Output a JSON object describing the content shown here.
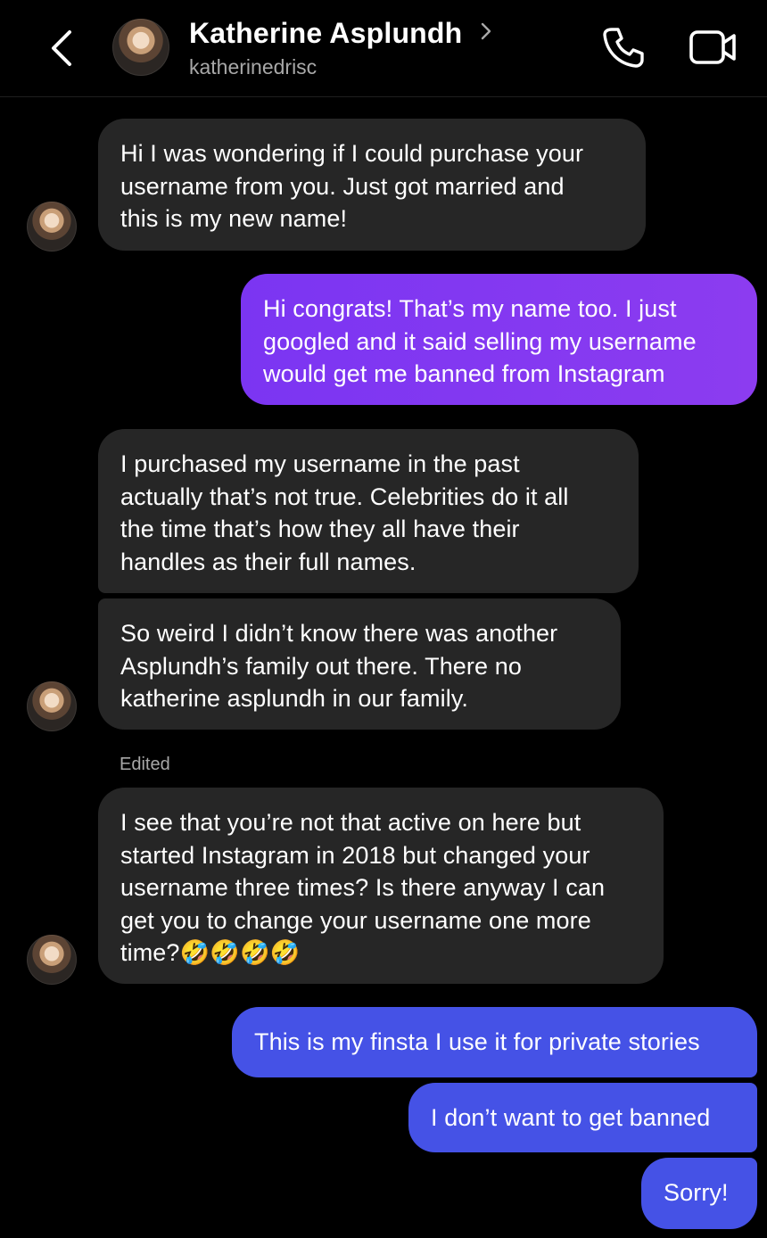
{
  "header": {
    "contact_name": "Katherine Asplundh",
    "username": "katherinedrisc"
  },
  "messages": [
    {
      "side": "incoming",
      "text": "Hi I was wondering if I could purchase your\nusername from you. Just got married and\nthis is my new name!"
    },
    {
      "side": "outgoing",
      "text": "Hi congrats! That’s my name too. I just\ngoogled and it said selling my username\nwould get me banned from Instagram"
    },
    {
      "side": "incoming",
      "text": "I purchased my username in the past\nactually that’s not true. Celebrities do it all\nthe time that’s how they all have their\nhandles as their full names."
    },
    {
      "side": "incoming",
      "text": "So weird I didn’t know there was another\nAsplundh’s family out there. There no\nkatherine asplundh in our family."
    },
    {
      "side": "incoming",
      "text": "I see that you’re not that active on here but\nstarted Instagram in 2018 but changed your\nusername three times? Is there anyway I can\nget you to change your username one more\ntime?🤣🤣🤣🤣"
    },
    {
      "side": "outgoing",
      "text": "This is my finsta I use it for private stories"
    },
    {
      "side": "outgoing",
      "text": "I don’t want to get banned"
    },
    {
      "side": "outgoing",
      "text": "Sorry!"
    }
  ],
  "edited_label": "Edited",
  "colors": {
    "background": "#000000",
    "incoming_bubble": "#262626",
    "outgoing_purple": "#8a3cf0",
    "outgoing_blue": "#4552e6",
    "secondary_text": "#a8a8a8"
  },
  "icons": [
    "back-arrow-icon",
    "chevron-right-icon",
    "phone-icon",
    "video-camera-icon"
  ]
}
